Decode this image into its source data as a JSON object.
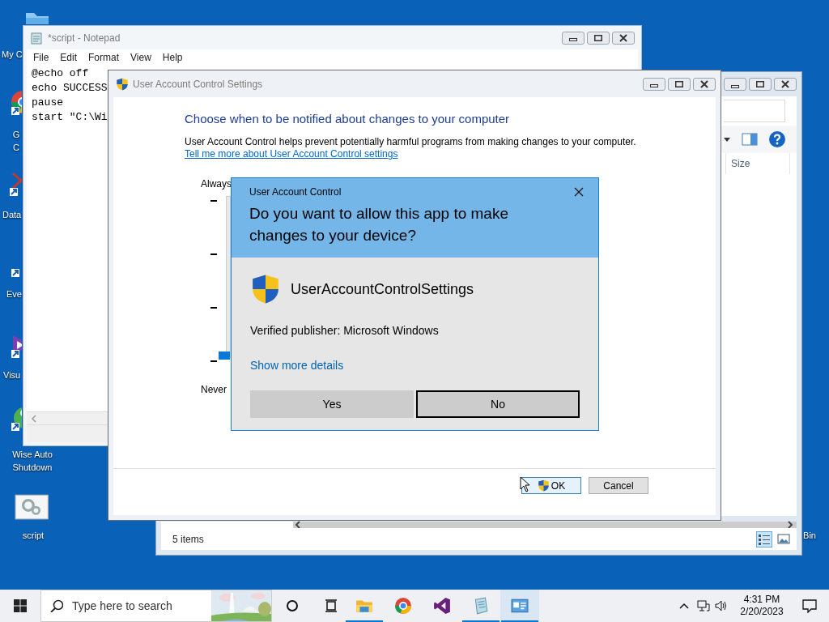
{
  "desktop_icons": [
    {
      "kind": "computer",
      "label": "My C"
    },
    {
      "kind": "chrome",
      "label": "G\nC"
    },
    {
      "kind": "data",
      "label": "Data"
    },
    {
      "kind": "shortcut",
      "label": "Eve"
    },
    {
      "kind": "vs",
      "label": "Visu"
    },
    {
      "kind": "wise",
      "label": "Wise Auto\nShutdown"
    },
    {
      "kind": "script",
      "label": "script"
    },
    {
      "kind": "recycle",
      "label": "Bin"
    }
  ],
  "explorer": {
    "columns": [
      "Size"
    ],
    "status": "5 items"
  },
  "notepad": {
    "title": "*script - Notepad",
    "menu": [
      "File",
      "Edit",
      "Format",
      "View",
      "Help"
    ],
    "lines": [
      "@echo off",
      "echo SUCCESS",
      "pause",
      "start \"C:\\Wi"
    ]
  },
  "uac_settings": {
    "title": "User Account Control Settings",
    "heading": "Choose when to be notified about changes to your computer",
    "description": "User Account Control helps prevent potentially harmful programs from making changes to your computer.",
    "link": "Tell me more about User Account Control settings",
    "top_label": "Always",
    "bottom_label": "Never",
    "slider": {
      "level": 0
    },
    "buttons": [
      {
        "label": "OK",
        "shield": true,
        "focused": true
      },
      {
        "label": "Cancel",
        "shield": false,
        "focused": false
      }
    ]
  },
  "uac_prompt": {
    "title": "User Account Control",
    "question": "Do you want to allow this app to make changes to your device?",
    "app": "UserAccountControlSettings",
    "publisher": "Verified publisher: Microsoft Windows",
    "details_link": "Show more details",
    "buttons": [
      {
        "label": "Yes",
        "focused": false
      },
      {
        "label": "No",
        "focused": true
      }
    ]
  },
  "taskbar": {
    "search_placeholder": "Type here to search",
    "apps": [
      {
        "kind": "explorer",
        "running": true,
        "active": false
      },
      {
        "kind": "chrome",
        "running": false,
        "active": false
      },
      {
        "kind": "vs",
        "running": false,
        "active": false
      },
      {
        "kind": "notepad",
        "running": true,
        "active": false
      },
      {
        "kind": "uac",
        "running": true,
        "active": true
      }
    ],
    "time": "4:31 PM",
    "date": "2/20/2023"
  }
}
